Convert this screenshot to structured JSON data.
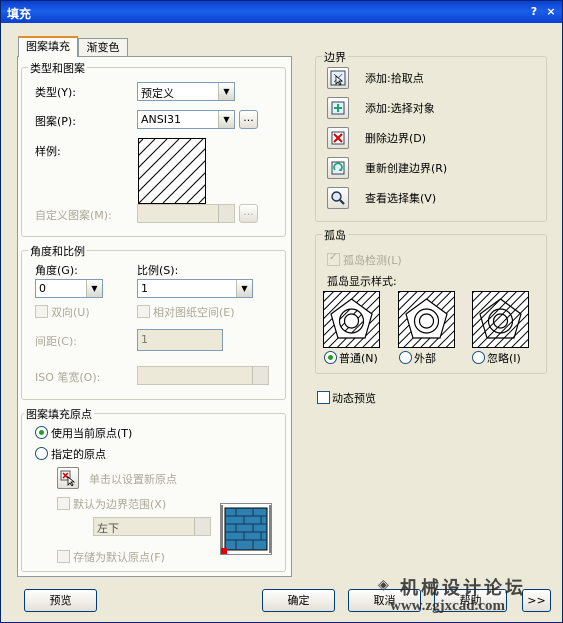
{
  "window": {
    "title": "填充",
    "help_icon": "?",
    "close_icon": "×"
  },
  "tabs": [
    {
      "label": "图案填充"
    },
    {
      "label": "渐变色"
    }
  ],
  "type_pattern": {
    "title": "类型和图案",
    "type_label": "类型(Y):",
    "type_value": "预定义",
    "pattern_label": "图案(P):",
    "pattern_value": "ANSI31",
    "pattern_browse": "...",
    "sample_label": "样例:",
    "custom_label": "自定义图案(M):",
    "custom_browse": "..."
  },
  "angle_scale": {
    "title": "角度和比例",
    "angle_label": "角度(G):",
    "angle_value": "0",
    "scale_label": "比例(S):",
    "scale_value": "1",
    "double_label": "双向(U)",
    "relative_label": "相对图纸空间(E)",
    "spacing_label": "间距(C):",
    "spacing_value": "1",
    "iso_label": "ISO 笔宽(O):"
  },
  "origin": {
    "title": "图案填充原点",
    "use_current_label": "使用当前原点(T)",
    "specified_label": "指定的原点",
    "click_set_label": "单击以设置新原点",
    "default_extents_label": "默认为边界范围(X)",
    "position_value": "左下",
    "store_default_label": "存储为默认原点(F)"
  },
  "boundary": {
    "title": "边界",
    "add_pick_label": "添加:拾取点",
    "add_select_label": "添加:选择对象",
    "remove_label": "删除边界(D)",
    "recreate_label": "重新创建边界(R)",
    "view_label": "查看选择集(V)"
  },
  "islands": {
    "title": "孤岛",
    "detect_label": "孤岛检测(L)",
    "style_label": "孤岛显示样式:",
    "normal_label": "普通(N)",
    "outer_label": "外部",
    "ignore_label": "忽略(I)"
  },
  "dynamic_preview_label": "动态预览",
  "buttons": {
    "preview": "预览",
    "ok": "确定",
    "cancel": "取消",
    "help": "帮助",
    "more": ">>"
  },
  "watermark": {
    "text": "机械设计论坛",
    "url": "www.zgjxcad.com"
  }
}
